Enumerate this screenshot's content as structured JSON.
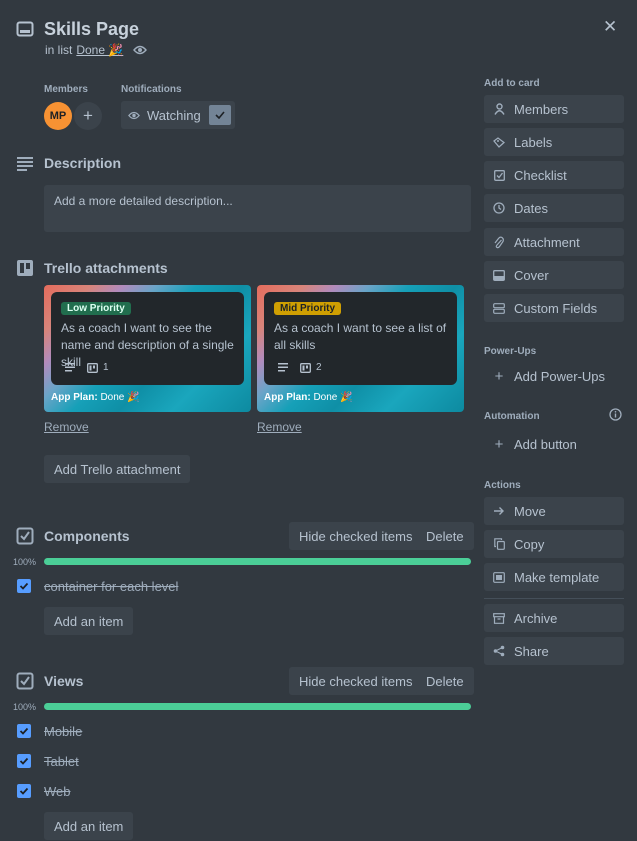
{
  "header": {
    "title": "Skills Page",
    "list_prefix": "in list",
    "list_name": "Done 🎉",
    "close_label": "✕"
  },
  "members": {
    "label": "Members",
    "avatar": "MP",
    "add_label": "+"
  },
  "notifications": {
    "label": "Notifications",
    "button": "Watching"
  },
  "description": {
    "title": "Description",
    "placeholder": "Add a more detailed description..."
  },
  "attachments": {
    "title": "Trello attachments",
    "cards": [
      {
        "tag": "Low Priority",
        "tag_color": "#216e4e",
        "title": "As a coach I want to see the name and description of a single skill",
        "checklist_count": "1",
        "footer_label": "App Plan:",
        "footer_list": "Done 🎉",
        "remove": "Remove"
      },
      {
        "tag": "Mid Priority",
        "tag_color": "#cf9f02",
        "title": "As a coach I want to see a list of all skills",
        "checklist_count": "2",
        "footer_label": "App Plan:",
        "footer_list": "Done 🎉",
        "remove": "Remove"
      }
    ],
    "add_button": "Add Trello attachment"
  },
  "checklists": [
    {
      "title": "Components",
      "hide_button": "Hide checked items",
      "delete_button": "Delete",
      "percent": "100%",
      "progress": 1.0,
      "items": [
        "container for each level"
      ],
      "add_item": "Add an item"
    },
    {
      "title": "Views",
      "hide_button": "Hide checked items",
      "delete_button": "Delete",
      "percent": "100%",
      "progress": 1.0,
      "items": [
        "Mobile",
        "Tablet",
        "Web"
      ],
      "add_item": "Add an item"
    }
  ],
  "sidebar": {
    "add_to_card_label": "Add to card",
    "add_to_card": [
      "Members",
      "Labels",
      "Checklist",
      "Dates",
      "Attachment",
      "Cover",
      "Custom Fields"
    ],
    "powerups_label": "Power-Ups",
    "add_powerups": "Add Power-Ups",
    "automation_label": "Automation",
    "add_button": "Add button",
    "actions_label": "Actions",
    "actions": [
      "Move",
      "Copy",
      "Make template"
    ],
    "actions_more": [
      "Archive",
      "Share"
    ]
  },
  "colors": {
    "background": "#323940",
    "button": "#3b434b",
    "progress": "#4bce97",
    "checkbox": "#579dff",
    "avatar": "#f79233"
  }
}
